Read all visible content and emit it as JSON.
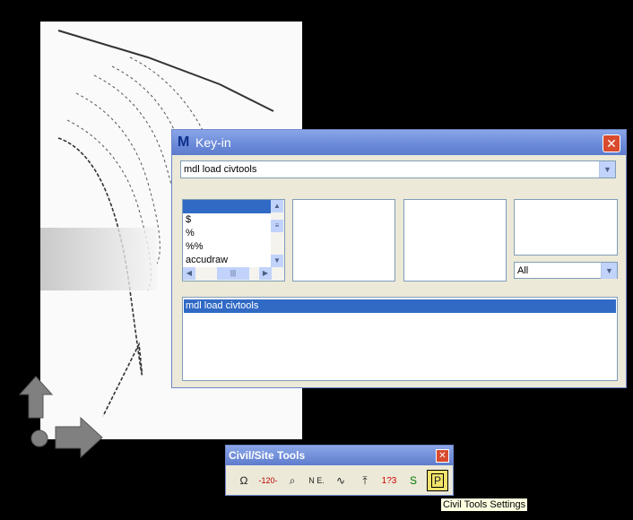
{
  "keyin": {
    "title": "Key-in",
    "input_value": "mdl load civtools",
    "commands": [
      "",
      "$",
      "%",
      "%%",
      "accudraw"
    ],
    "filter_value": "All",
    "history": [
      "mdl load civtools"
    ]
  },
  "civil_tools": {
    "title": "Civil/Site Tools",
    "tooltip": "Civil Tools Settings",
    "tools": [
      "tool-1",
      "tool-2",
      "tool-3",
      "tool-4",
      "tool-5",
      "tool-6",
      "tool-7",
      "tool-8",
      "tool-9"
    ]
  },
  "colors": {
    "titlebar": "#6a89d8",
    "selection": "#316ac5",
    "close": "#d94b2e"
  }
}
